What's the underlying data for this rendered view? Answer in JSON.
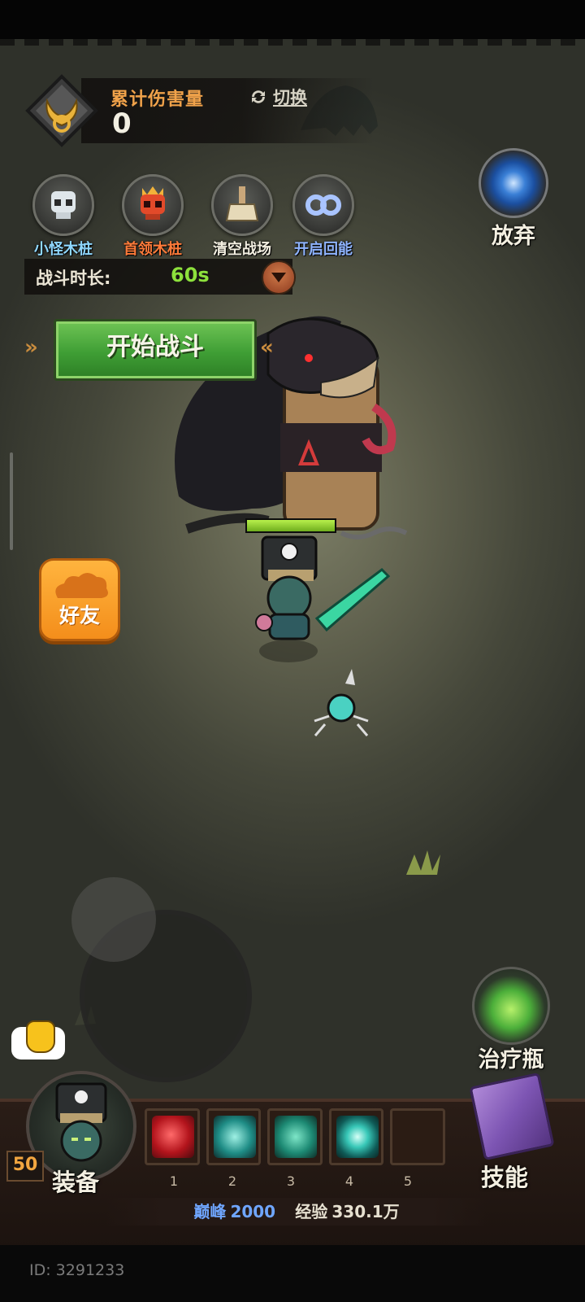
{
  "hud": {
    "damage_title": "累计伤害量",
    "damage_value": "0",
    "switch_label": "切换",
    "give_up_label": "放弃"
  },
  "dummy_buttons": [
    {
      "label": "小怪木桩",
      "color": "#8fd7ff",
      "icon": "skull-icon"
    },
    {
      "label": "首领木桩",
      "color": "#ff7b3a",
      "icon": "crowned-skull-icon"
    },
    {
      "label": "清空战场",
      "color": "#f3efe1",
      "icon": "broom-icon"
    },
    {
      "label": "开启回能",
      "color": "#8fb4ff",
      "icon": "infinity-icon"
    }
  ],
  "duration": {
    "label": "战斗时长:",
    "value": "60s"
  },
  "start_battle_label": "开始战斗",
  "friends_label": "好友",
  "potion_label": "治疗瓶",
  "equip_label": "装备",
  "skill_label": "技能",
  "level": "50",
  "skill_slots": [
    "1",
    "2",
    "3",
    "4",
    "5"
  ],
  "rank": {
    "peak_label": "巅峰",
    "peak_value": "2000",
    "exp_label": "经验",
    "exp_value": "330.1万"
  },
  "player_id": "ID: 3291233",
  "colors": {
    "accent_orange": "#f0a24a",
    "duration_green": "#8de13c",
    "rank_blue": "#6fa6ff"
  }
}
